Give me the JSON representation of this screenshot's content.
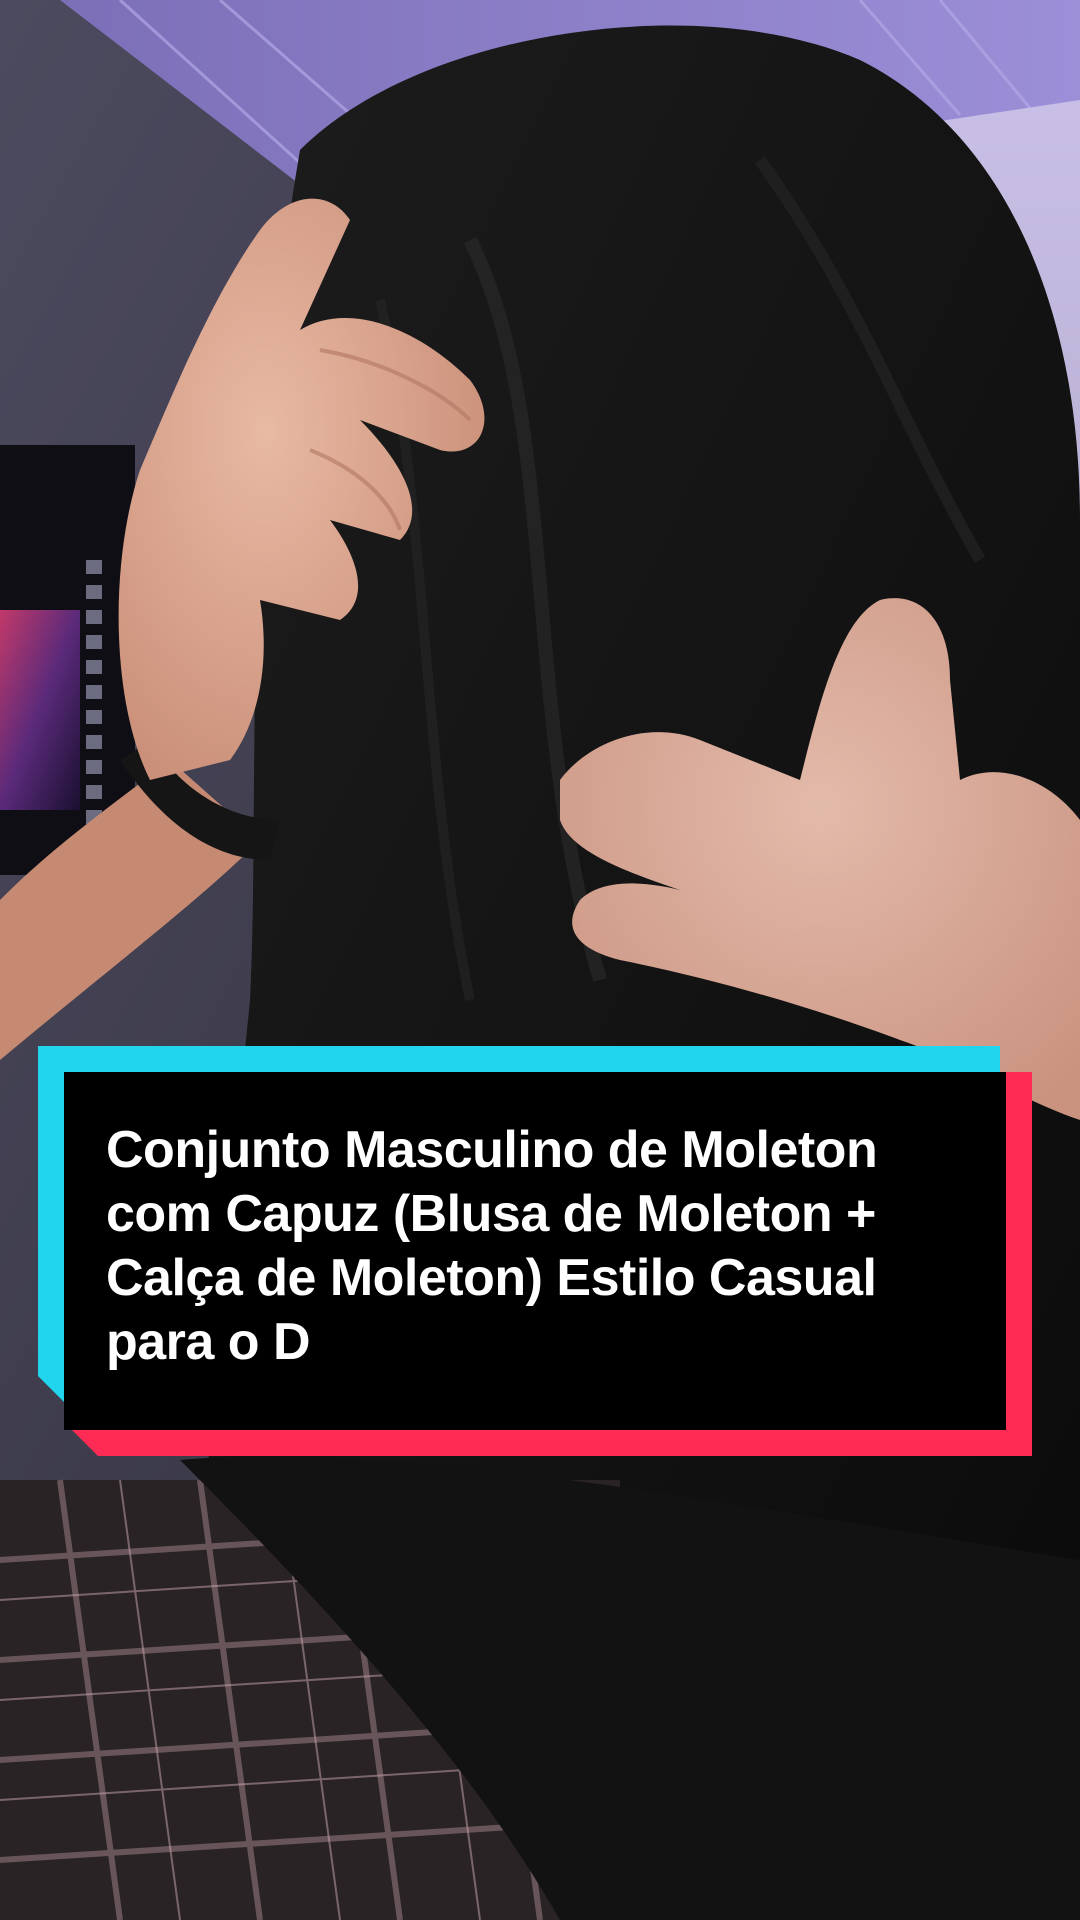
{
  "caption": {
    "text": "Conjunto Masculino de Moleton com Capuz (Blusa de Moleton + Calça de Moleton) Estilo Casual para o D"
  },
  "colors": {
    "accent_cyan": "#20d5ec",
    "accent_red": "#fe2c55",
    "caption_bg": "#000000",
    "caption_text": "#ffffff"
  },
  "background": {
    "description_icon": "video-frame-image"
  }
}
